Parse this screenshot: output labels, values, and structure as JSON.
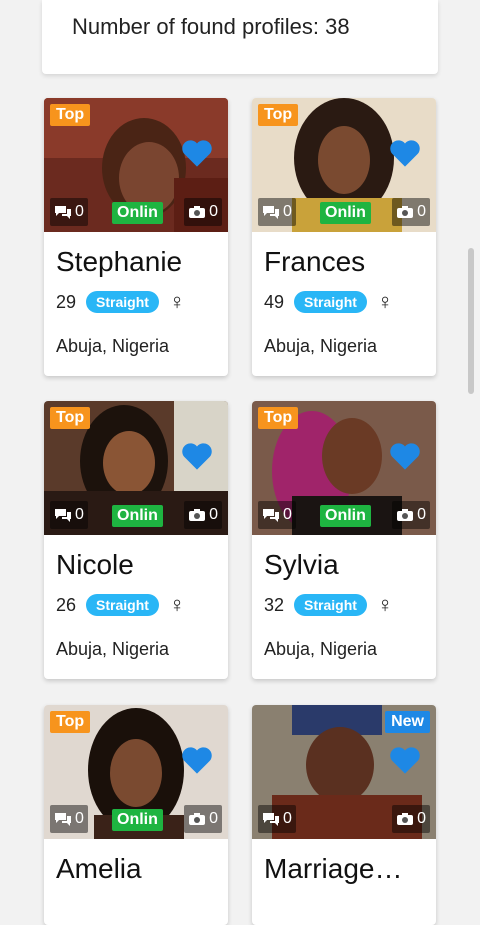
{
  "header": {
    "found_text": "Number of found profiles: 38"
  },
  "profiles": [
    {
      "name": "Stephanie",
      "age": "29",
      "orientation": "Straight",
      "gender_symbol": "♀",
      "location": "Abuja, Nigeria",
      "badge": "Top",
      "online": "Onlin",
      "messages": "0",
      "photos": "0"
    },
    {
      "name": "Frances",
      "age": "49",
      "orientation": "Straight",
      "gender_symbol": "♀",
      "location": "Abuja, Nigeria",
      "badge": "Top",
      "online": "Onlin",
      "messages": "0",
      "photos": "0"
    },
    {
      "name": "Nicole",
      "age": "26",
      "orientation": "Straight",
      "gender_symbol": "♀",
      "location": "Abuja, Nigeria",
      "badge": "Top",
      "online": "Onlin",
      "messages": "0",
      "photos": "0"
    },
    {
      "name": "Sylvia",
      "age": "32",
      "orientation": "Straight",
      "gender_symbol": "♀",
      "location": "Abuja, Nigeria",
      "badge": "Top",
      "online": "Onlin",
      "messages": "0",
      "photos": "0"
    },
    {
      "name": "Amelia",
      "age": "",
      "orientation": "",
      "gender_symbol": "",
      "location": "",
      "badge": "Top",
      "online": "Onlin",
      "messages": "0",
      "photos": "0"
    },
    {
      "name": "Marriage…",
      "age": "",
      "orientation": "",
      "gender_symbol": "",
      "location": "",
      "badge": "New",
      "online": "",
      "messages": "0",
      "photos": "0"
    }
  ],
  "colors": {
    "top_badge": "#f7941d",
    "new_badge": "#1e88e5",
    "online": "#1eb441",
    "pill": "#29b6f6",
    "heart": "#1e88e5"
  }
}
